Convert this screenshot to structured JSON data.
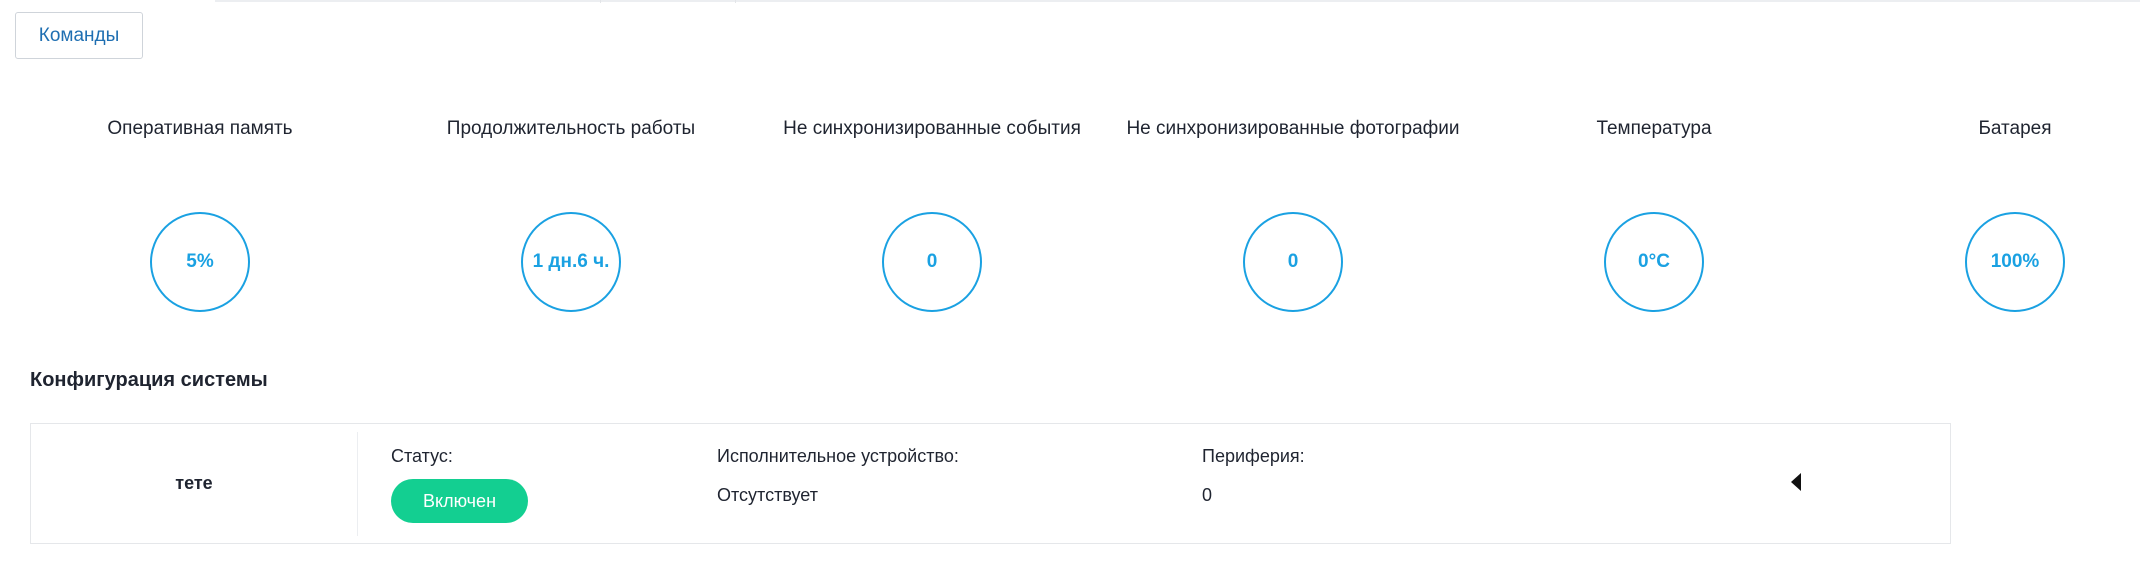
{
  "toolbar": {
    "commands_label": "Команды"
  },
  "metrics": [
    {
      "label": "Оперативная память",
      "value": "5%"
    },
    {
      "label": "Продолжительность работы",
      "value": "1 дн.6 ч."
    },
    {
      "label": "Не синхронизированные события",
      "value": "0"
    },
    {
      "label": "Не синхронизированные фотографии",
      "value": "0"
    },
    {
      "label": "Температура",
      "value": "0°C"
    },
    {
      "label": "Батарея",
      "value": "100%"
    }
  ],
  "system_config": {
    "title": "Конфигурация системы",
    "device": {
      "name": "тете",
      "status_label": "Статус:",
      "status_value": "Включен",
      "executor_label": "Исполнительное устройство:",
      "executor_value": "Отсутствует",
      "peripherals_label": "Периферия:",
      "peripherals_value": "0"
    }
  },
  "icons": {
    "expand_toggle": "caret-left-icon"
  },
  "colors": {
    "accent": "#1aa1e2",
    "status_on": "#13cf91",
    "button_text": "#1f6fb2",
    "text": "#1f2430"
  }
}
